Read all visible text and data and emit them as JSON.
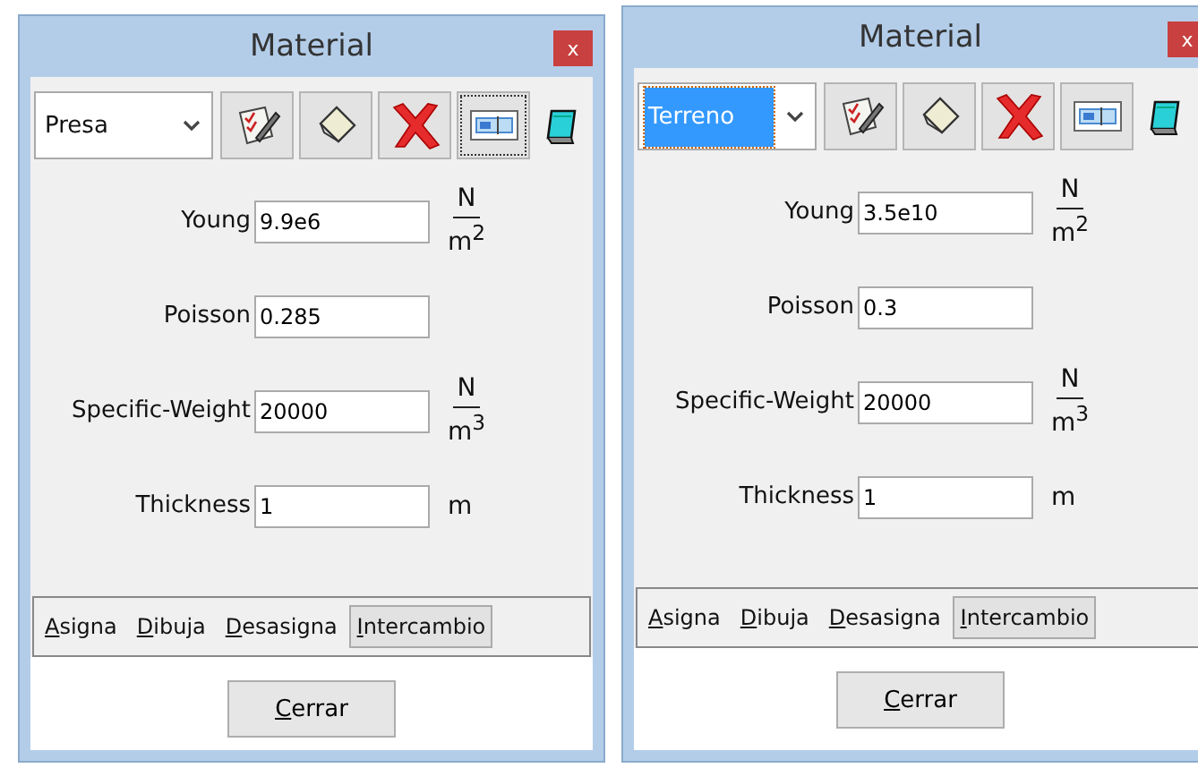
{
  "windows": [
    {
      "title": "Material",
      "close": "x",
      "material": {
        "value": "Presa",
        "focused": false
      },
      "toolbar": [
        {
          "kind": "edit",
          "focused": false
        },
        {
          "kind": "sheet",
          "focused": false
        },
        {
          "kind": "delete",
          "focused": false
        },
        {
          "kind": "form",
          "focused": true
        },
        {
          "kind": "notebook",
          "focused": false
        }
      ],
      "properties": [
        {
          "kind": "fraction",
          "label": "Young",
          "value": "9.9e6",
          "numerator": "N",
          "denominator": "m$^{2}$"
        },
        {
          "kind": "none",
          "label": "Poisson",
          "value": "0.285"
        },
        {
          "kind": "fraction",
          "label": "Specific-Weight",
          "value": "20000",
          "numerator": "N",
          "denominator": "m$^{3}$"
        },
        {
          "kind": "simple",
          "label": "Thickness",
          "value": "1",
          "unit": "m"
        }
      ],
      "tabs": [
        {
          "label": "Asigna",
          "selected": false
        },
        {
          "label": "Dibuja",
          "selected": false
        },
        {
          "label": "Desasigna",
          "selected": false
        },
        {
          "label": "Intercambio",
          "selected": true
        }
      ],
      "button": "Cerrar"
    },
    {
      "title": "Material",
      "close": "x",
      "material": {
        "value": "Terreno",
        "focused": true
      },
      "toolbar": [
        {
          "kind": "edit",
          "focused": false
        },
        {
          "kind": "sheet",
          "focused": false
        },
        {
          "kind": "delete",
          "focused": false
        },
        {
          "kind": "form",
          "focused": false
        },
        {
          "kind": "notebook",
          "focused": false
        }
      ],
      "properties": [
        {
          "kind": "fraction",
          "label": "Young",
          "value": "3.5e10",
          "numerator": "N",
          "denominator": "m$^{2}$"
        },
        {
          "kind": "none",
          "label": "Poisson",
          "value": "0.3"
        },
        {
          "kind": "fraction",
          "label": "Specific-Weight",
          "value": "20000",
          "numerator": "N",
          "denominator": "m$^{3}$"
        },
        {
          "kind": "simple",
          "label": "Thickness",
          "value": "1",
          "unit": "m"
        }
      ],
      "tabs": [
        {
          "label": "Asigna",
          "selected": false
        },
        {
          "label": "Dibuja",
          "selected": false
        },
        {
          "label": "Desasigna",
          "selected": false
        },
        {
          "label": "Intercambio",
          "selected": true
        }
      ],
      "button": "Cerrar"
    }
  ]
}
